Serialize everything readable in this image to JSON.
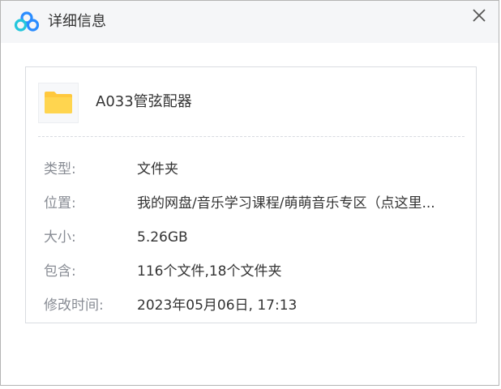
{
  "window": {
    "title": "详细信息",
    "close_icon": "close-icon",
    "logo_icon": "baidu-netdisk-cloud-logo"
  },
  "file": {
    "name": "A033管弦配器",
    "icon": "folder-icon",
    "folder_color": "#ffc83d"
  },
  "details": [
    {
      "label": "类型:",
      "value": "文件夹"
    },
    {
      "label": "位置:",
      "value": "我的网盘/音乐学习课程/萌萌音乐专区（点这里..."
    },
    {
      "label": "大小:",
      "value": "5.26GB"
    },
    {
      "label": "包含:",
      "value": "116个文件,18个文件夹"
    },
    {
      "label": "修改时间:",
      "value": "2023年05月06日, 17:13"
    }
  ],
  "colors": {
    "logo_blue": "#2a8cff",
    "logo_cyan": "#24c6dc",
    "label_gray": "#888c94",
    "value_dark": "#333333"
  }
}
